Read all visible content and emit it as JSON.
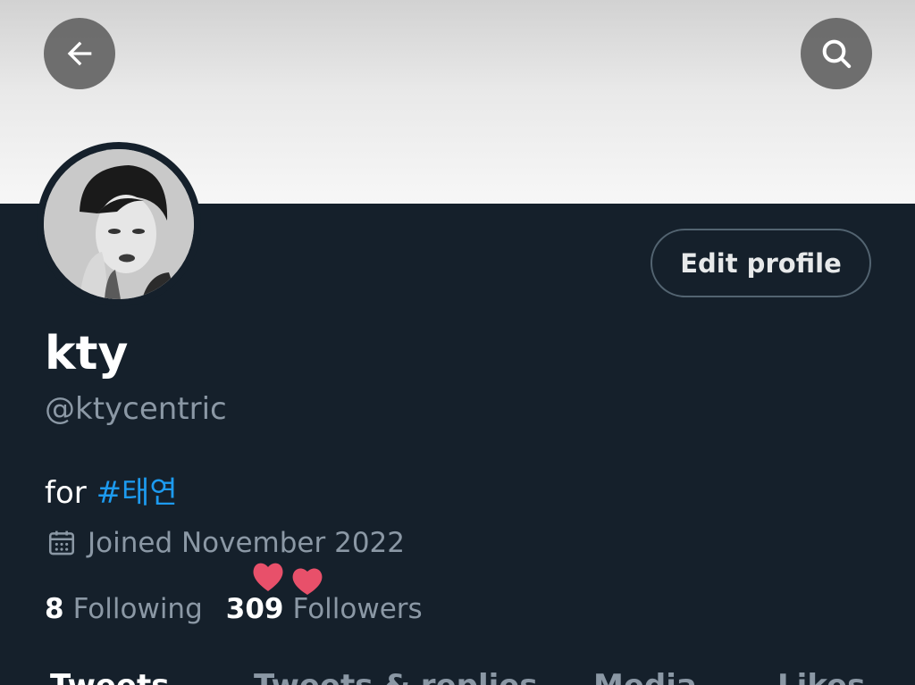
{
  "header": {
    "back_icon": "arrow-left-icon",
    "search_icon": "search-icon"
  },
  "profile": {
    "edit_button": "Edit profile",
    "display_name": "kty",
    "handle": "@ktycentric",
    "bio_prefix": "for ",
    "bio_hashtag": "#태연",
    "joined": "Joined November 2022",
    "following_count": "8",
    "following_label": "Following",
    "followers_count": "309",
    "followers_label": "Followers"
  },
  "tabs": [
    {
      "label": "Tweets",
      "active": true
    },
    {
      "label": "Tweets & replies",
      "active": false
    },
    {
      "label": "Media",
      "active": false
    },
    {
      "label": "Likes",
      "active": false
    }
  ],
  "colors": {
    "background": "#15202b",
    "accent": "#1d9bf0",
    "muted": "#8b98a5",
    "heart": "#e8506a"
  }
}
